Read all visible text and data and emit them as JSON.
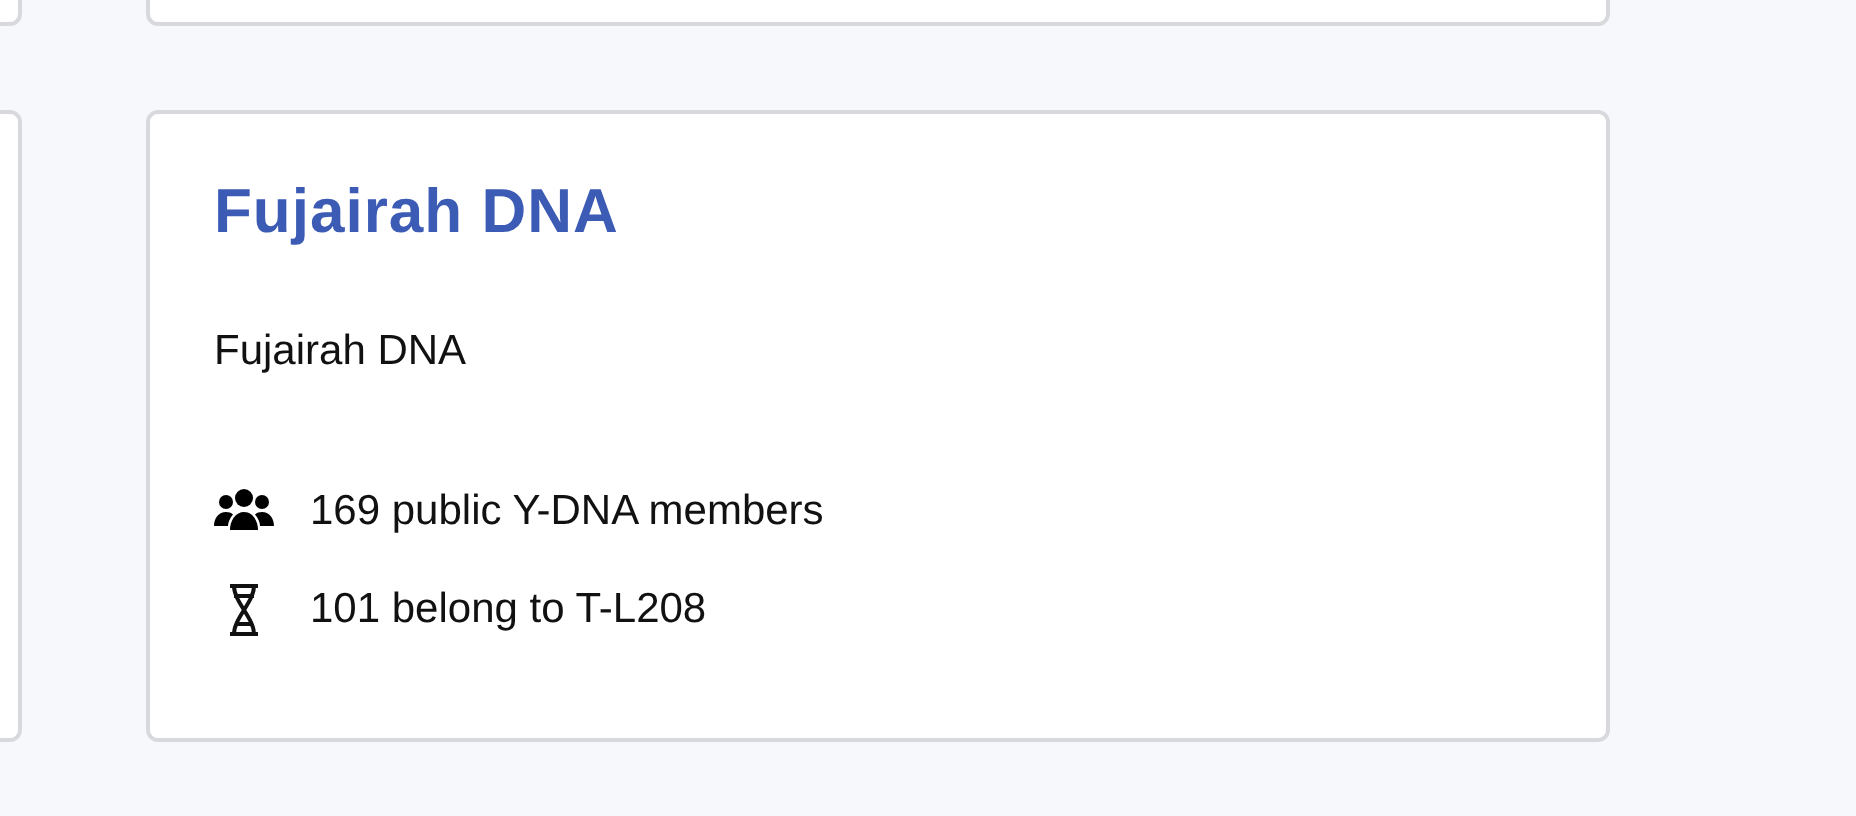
{
  "card": {
    "title": "Fujairah DNA",
    "description": "Fujairah DNA",
    "stats": [
      {
        "kind": "members",
        "text": "169 public Y-DNA members"
      },
      {
        "kind": "haplogroup",
        "text": "101 belong to T-L208"
      }
    ]
  }
}
